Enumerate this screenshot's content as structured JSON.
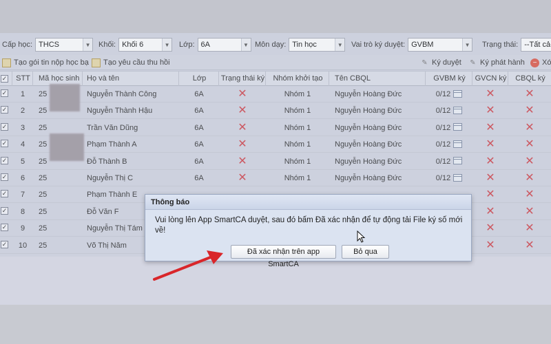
{
  "filters": [
    {
      "label": "Cấp học:",
      "value": "THCS"
    },
    {
      "label": "Khối:",
      "value": "Khối 6"
    },
    {
      "label": "Lớp:",
      "value": "6A"
    },
    {
      "label": "Môn dạy:",
      "value": "Tin học"
    },
    {
      "label": "Vai trò ký duyệt:",
      "value": "GVBM"
    },
    {
      "label": "Trạng thái:",
      "value": "--Tất cả-"
    }
  ],
  "toolbar": {
    "create_package": "Tạo gói tin nộp học bạ",
    "create_request": "Tạo yêu cầu thu hồi",
    "approve": "Ký duyệt",
    "issue": "Ký phát hành",
    "delete": "Xó"
  },
  "table": {
    "headers": [
      "",
      "STT",
      "Mã học sinh",
      "Họ và tên",
      "Lớp",
      "Trạng thái ký",
      "Nhóm khởi tạo",
      "Tên CBQL",
      "GVBM ký",
      "GVCN ký",
      "CBQL ký"
    ],
    "rows": [
      {
        "stt": "1",
        "code": "25",
        "name": "Nguyễn Thành Công",
        "class": "6A",
        "group": "Nhóm 1",
        "manager": "Nguyễn Hoàng Đức",
        "gvbm": "0/12"
      },
      {
        "stt": "2",
        "code": "25",
        "name": "Nguyễn Thành Hậu",
        "class": "6A",
        "group": "Nhóm 1",
        "manager": "Nguyễn Hoàng Đức",
        "gvbm": "0/12"
      },
      {
        "stt": "3",
        "code": "25",
        "name": "Trần Văn Dũng",
        "class": "6A",
        "group": "Nhóm 1",
        "manager": "Nguyễn Hoàng Đức",
        "gvbm": "0/12"
      },
      {
        "stt": "4",
        "code": "25",
        "name": "Phạm Thành A",
        "class": "6A",
        "group": "Nhóm 1",
        "manager": "Nguyễn Hoàng Đức",
        "gvbm": "0/12"
      },
      {
        "stt": "5",
        "code": "25",
        "name": "Đỗ Thành B",
        "class": "6A",
        "group": "Nhóm 1",
        "manager": "Nguyễn Hoàng Đức",
        "gvbm": "0/12"
      },
      {
        "stt": "6",
        "code": "25",
        "name": "Nguyễn Thị C",
        "class": "6A",
        "group": "Nhóm 1",
        "manager": "Nguyễn Hoàng Đức",
        "gvbm": "0/12"
      },
      {
        "stt": "7",
        "code": "25",
        "name": "Phạm Thành E",
        "class": "",
        "group": "",
        "manager": "",
        "gvbm": ""
      },
      {
        "stt": "8",
        "code": "25",
        "name": "Đỗ Văn F",
        "class": "",
        "group": "",
        "manager": "",
        "gvbm": ""
      },
      {
        "stt": "9",
        "code": "25",
        "name": "Nguyễn Thị Tám",
        "class": "",
        "group": "",
        "manager": "",
        "gvbm": ""
      },
      {
        "stt": "10",
        "code": "25",
        "name": "Võ Thị Năm",
        "class": "",
        "group": "",
        "manager": "",
        "gvbm": ""
      }
    ]
  },
  "dialog": {
    "title": "Thông báo",
    "message": "Vui lòng lên App SmartCA duyệt, sau đó bấm Đã xác nhận để tự động tải File ký số mới về!",
    "confirm": "Đã xác nhận trên app SmartCA",
    "skip": "Bỏ qua"
  },
  "colors": {
    "x_mark": "#d2444b",
    "annotation_arrow": "#d9262a"
  }
}
